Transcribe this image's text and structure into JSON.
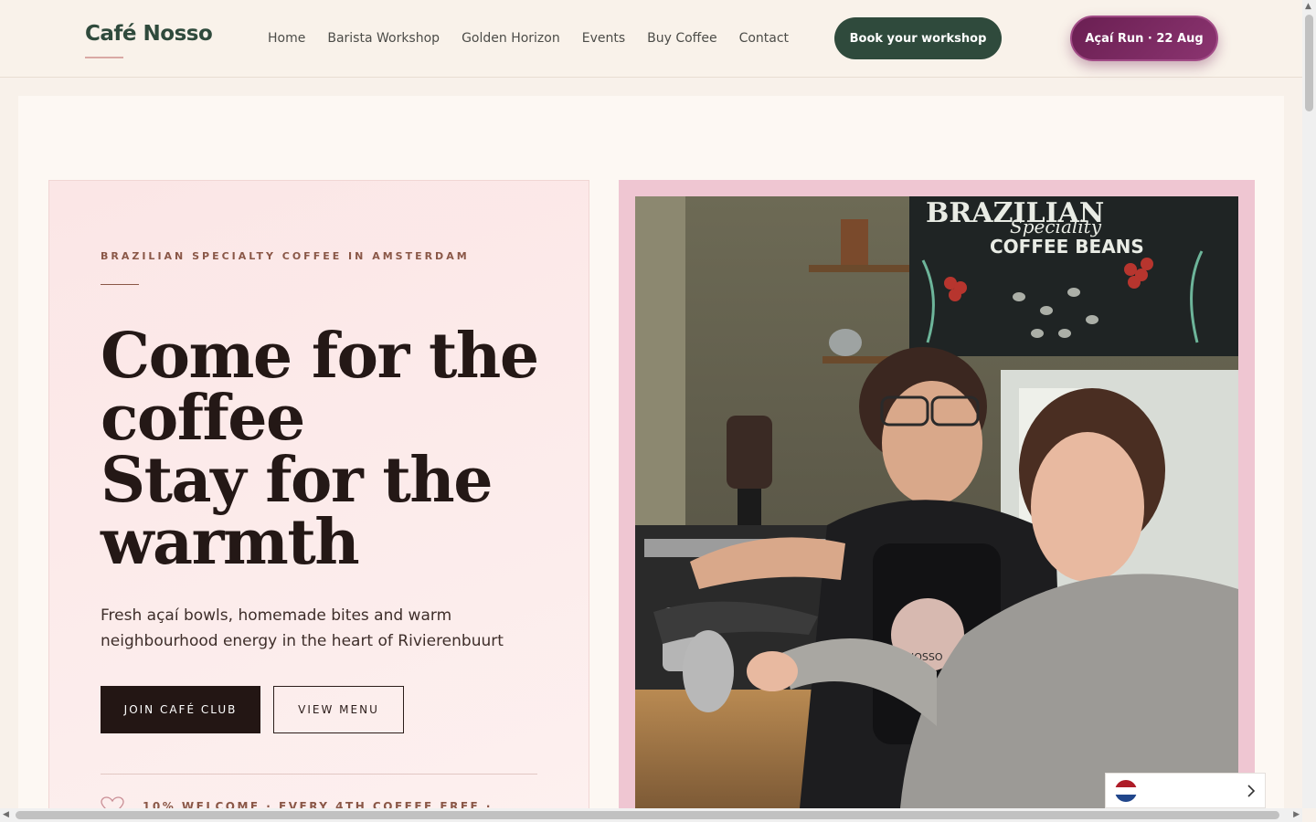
{
  "header": {
    "logo": "Café Nosso",
    "nav": [
      "Home",
      "Barista Workshop",
      "Golden Horizon",
      "Events",
      "Buy Coffee",
      "Contact"
    ],
    "workshop_button": "Book your workshop",
    "acai_button": "Açaí Run · 22 Aug"
  },
  "hero": {
    "eyebrow": "BRAZILIAN SPECIALTY COFFEE IN AMSTERDAM",
    "headline": [
      "Come for the",
      "coffee",
      "Stay for the",
      "warmth"
    ],
    "subtext": "Fresh açaí bowls, homemade bites and warm neighbourhood energy in the heart of Rivierenbuurt",
    "primary_button": "JOIN CAFÉ CLUB",
    "secondary_button": "VIEW MENU",
    "perk_text": "10% WELCOME · EVERY 4TH COFFEE FREE ·"
  },
  "photo": {
    "chalkboard_line1": "BRAZILIAN",
    "chalkboard_line2": "Speciality",
    "chalkboard_line3": "COFFEE BEANS",
    "apron_text": "NOSSO"
  },
  "language": {
    "flag_icon": "netherlands-flag-icon"
  },
  "colors": {
    "brand_green": "#2f4a3c",
    "acai_purple": "#6a1f52",
    "blush": "#fbe6e6",
    "photo_frame": "#efc6d2"
  }
}
